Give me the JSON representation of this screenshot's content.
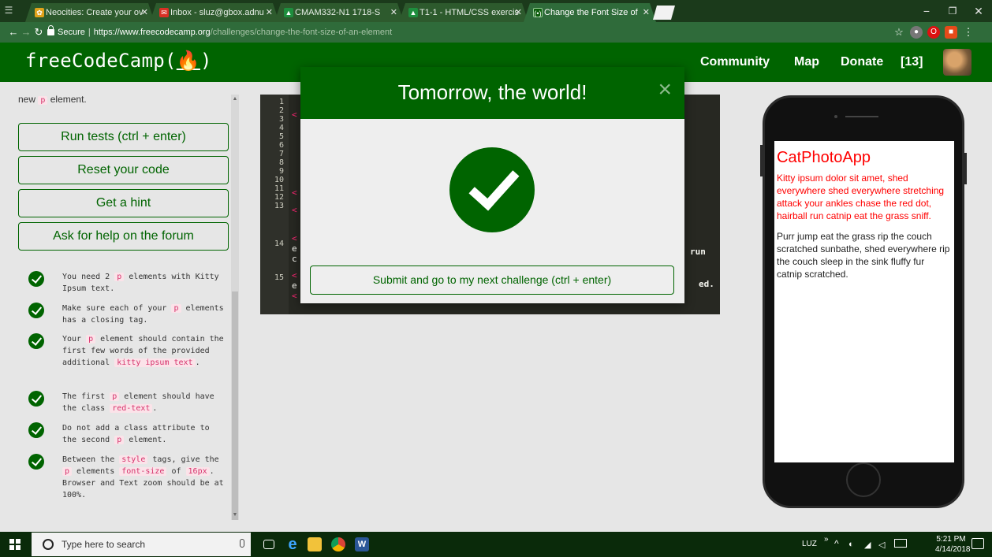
{
  "browser": {
    "tabs": [
      {
        "label": "Neocities: Create your ov",
        "favicon": "neocities-icon",
        "color": "#e0a21a"
      },
      {
        "label": "Inbox - sluz@gbox.adnu",
        "favicon": "gmail-icon",
        "color": "#d93025"
      },
      {
        "label": "CMAM332-N1 1718-S",
        "favicon": "classroom-icon",
        "color": "#1e8e3e"
      },
      {
        "label": "T1-1 - HTML/CSS exercis",
        "favicon": "classroom-icon",
        "color": "#1e8e3e"
      },
      {
        "label": "Change the Font Size of",
        "favicon": "fcc-icon",
        "color": "#006400"
      }
    ],
    "address": {
      "secure_label": "Secure",
      "separator": "|",
      "host": "https://www.freecodecamp.org",
      "path": "/challenges/change-the-font-size-of-an-element"
    }
  },
  "fcc": {
    "logo": "freeCodeCamp(🔥)",
    "logo_text": "freeCodeCamp(",
    "logo_end": ")",
    "nav": {
      "community": "Community",
      "map": "Map",
      "donate": "Donate",
      "points": "[13]"
    }
  },
  "left": {
    "instruction_tail_prefix": "new ",
    "instruction_tail_code": "p",
    "instruction_tail_suffix": " element.",
    "buttons": {
      "run_tests": "Run tests (ctrl + enter)",
      "reset": "Reset your code",
      "hint": "Get a hint",
      "forum": "Ask for help on the forum"
    },
    "tests": [
      {
        "parts": [
          "You need 2 ",
          "p",
          " elements with Kitty Ipsum text."
        ]
      },
      {
        "parts": [
          "Make sure each of your ",
          "p",
          " elements has a closing tag."
        ]
      },
      {
        "parts": [
          "Your ",
          "p",
          " element should contain the first few words of the provided additional ",
          "kitty ipsum text",
          "."
        ]
      },
      {
        "parts": [
          "The first ",
          "p",
          " element should have the class ",
          "red-text",
          "."
        ]
      },
      {
        "parts": [
          "Do not add a class attribute to the second ",
          "p",
          " element."
        ]
      },
      {
        "parts": [
          "Between the ",
          "style",
          " tags, give the ",
          "p",
          " elements ",
          "font-size",
          " of ",
          "16px",
          ". Browser and Text zoom should be at 100%."
        ]
      }
    ]
  },
  "editor": {
    "line_numbers": [
      "1",
      "2",
      "3",
      "4",
      "5",
      "6",
      "7",
      "8",
      "9",
      "10",
      "11",
      "12",
      "13",
      "",
      "",
      "14",
      "",
      "",
      "15"
    ],
    "visible_fragments": {
      "l2": "<",
      "l9": "<",
      "l11": "<",
      "l13a": "<",
      "l13b": "e",
      "l13c": "c",
      "l14a": "<",
      "l14b": "e",
      "l14c": "<",
      "run": "run",
      "ed": "ed."
    }
  },
  "preview": {
    "heading": "CatPhotoApp",
    "red_paragraph": "Kitty ipsum dolor sit amet, shed everywhere shed everywhere stretching attack your ankles chase the red dot, hairball run catnip eat the grass sniff.",
    "paragraph": "Purr jump eat the grass rip the couch scratched sunbathe, shed everywhere rip the couch sleep in the sink fluffy fur catnip scratched."
  },
  "modal": {
    "title": "Tomorrow, the world!",
    "close": "×",
    "submit": "Submit and go to my next challenge (ctrl + enter)"
  },
  "taskbar": {
    "search_placeholder": "Type here to search",
    "tray_lang": "LUZ",
    "tray_chevron": "»",
    "time": "5:21 PM",
    "date": "4/14/2018"
  },
  "colors": {
    "fcc_green": "#006400",
    "taskbar": "#0a2a0a",
    "panel": "#e6e6e6",
    "editor_bg": "#272822"
  }
}
